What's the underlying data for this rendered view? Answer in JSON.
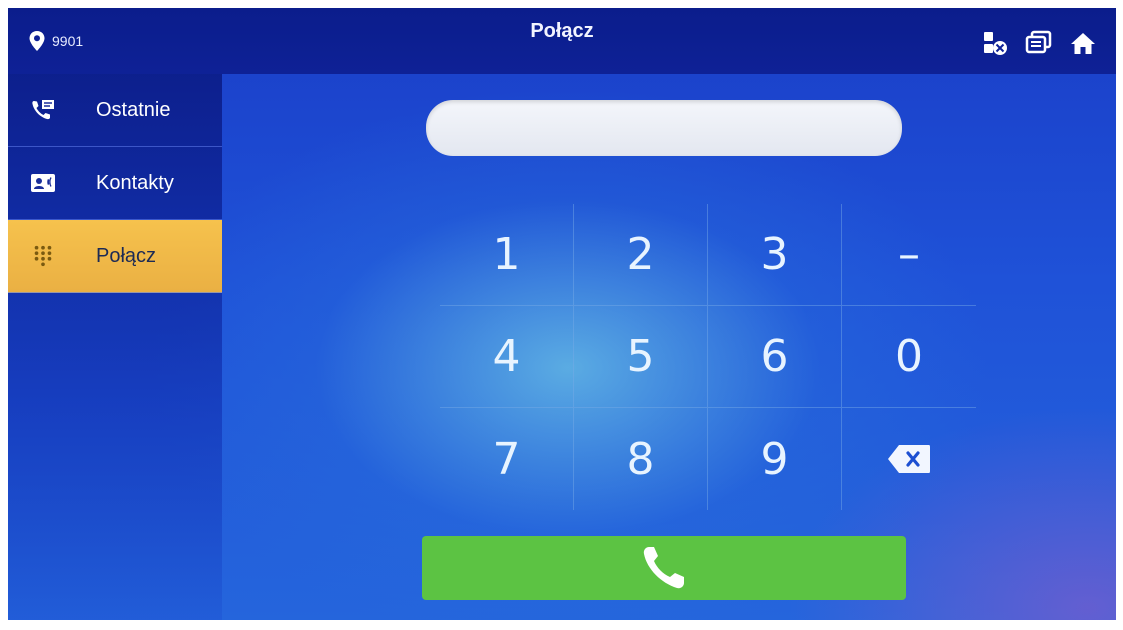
{
  "header": {
    "location_number": "9901",
    "title": "Połącz"
  },
  "sidebar": {
    "items": [
      {
        "label": "Ostatnie",
        "icon": "call-history-icon",
        "active": false
      },
      {
        "label": "Kontakty",
        "icon": "contacts-card-icon",
        "active": false
      },
      {
        "label": "Połącz",
        "icon": "dialpad-icon",
        "active": true
      }
    ]
  },
  "dialer": {
    "input_value": "",
    "keys": [
      "1",
      "2",
      "3",
      "–",
      "4",
      "5",
      "6",
      "0",
      "7",
      "8",
      "9"
    ],
    "backspace_icon": "backspace-icon",
    "call_icon": "phone-handset-icon"
  },
  "colors": {
    "topbar": "#0e2196",
    "active_tab": "#f6c24d",
    "call_button": "#5cc343"
  }
}
